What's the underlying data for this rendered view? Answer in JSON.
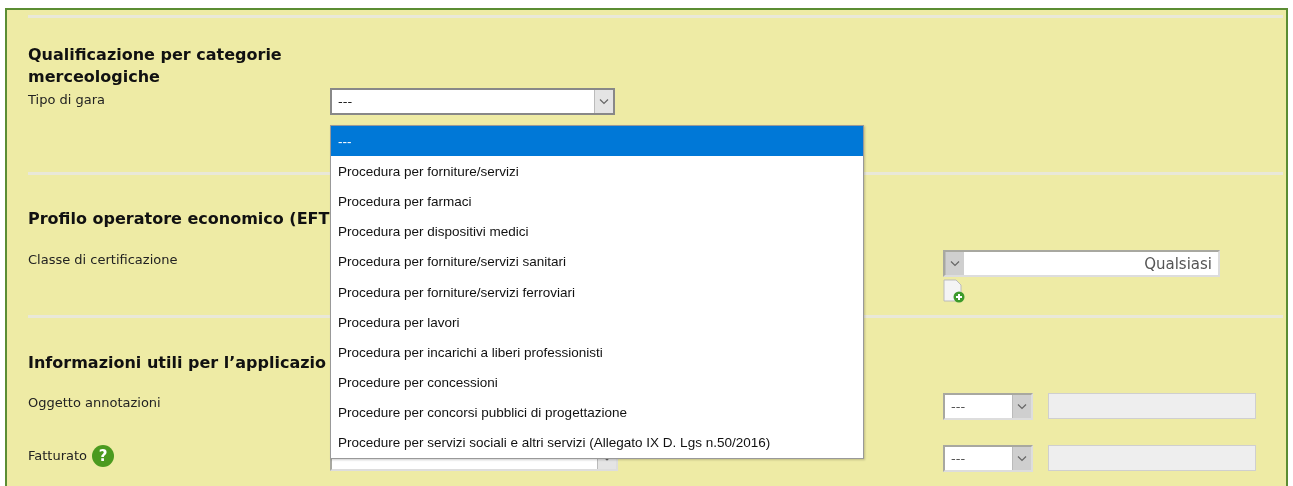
{
  "qualification": {
    "heading": "Qualificazione per categorie merceologiche",
    "label": "Tipo di gara",
    "select": {
      "value": "---",
      "open": true
    },
    "options": [
      {
        "label": "---",
        "selected": true
      },
      {
        "label": "Procedura per forniture/servizi",
        "selected": false
      },
      {
        "label": "Procedura per farmaci",
        "selected": false
      },
      {
        "label": "Procedura per dispositivi medici",
        "selected": false
      },
      {
        "label": "Procedura per forniture/servizi sanitari",
        "selected": false
      },
      {
        "label": "Procedura per forniture/servizi ferroviari",
        "selected": false
      },
      {
        "label": "Procedura per lavori",
        "selected": false
      },
      {
        "label": "Procedura per incarichi a liberi professionisti",
        "selected": false
      },
      {
        "label": "Procedure per concessioni",
        "selected": false
      },
      {
        "label": "Procedure per concorsi pubblici di progettazione",
        "selected": false
      },
      {
        "label": "Procedure per servizi sociali e altri servizi (Allegato IX D. Lgs n.50/2016)",
        "selected": false
      }
    ]
  },
  "profile": {
    "heading": "Profilo operatore economico (EFT",
    "label": "Classe di certificazione",
    "select": {
      "value": "Qualsiasi",
      "disabled": true
    }
  },
  "info": {
    "heading": "Informazioni utili per l’applicazio",
    "rows": [
      {
        "kind": "single",
        "label": "Oggetto annotazioni",
        "select": {
          "value": "---",
          "disabled": true
        }
      },
      {
        "kind": "double",
        "label": "Fatturato",
        "help": "?",
        "select": {
          "value": "---",
          "disabled": true
        }
      }
    ]
  }
}
